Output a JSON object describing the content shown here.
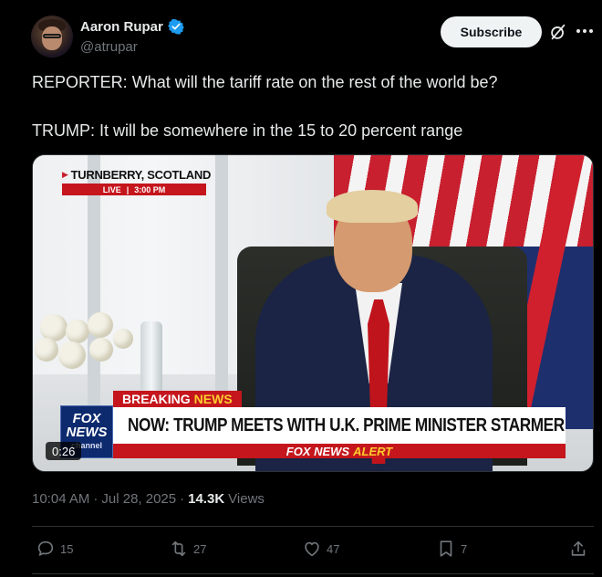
{
  "author": {
    "display_name": "Aaron Rupar",
    "handle": "@atrupar",
    "verified": true,
    "verified_color": "#1d9bf0"
  },
  "header": {
    "subscribe_label": "Subscribe",
    "grok_icon": "grok-icon",
    "more_icon": "more-icon"
  },
  "tweet": {
    "line1": "REPORTER: What will the tariff rate on the rest of the world be?",
    "line2": "TRUMP: It will be somewhere in the 15 to 20 percent range"
  },
  "video": {
    "location": "TURNBERRY, SCOTLAND",
    "live_label": "LIVE",
    "live_time": "3:00 PM",
    "breaking_word1": "BREAKING",
    "breaking_word2": "NEWS",
    "headline": "NOW: TRUMP MEETS WITH U.K. PRIME MINISTER STARMER",
    "alert_brand": "FOX NEWS",
    "alert_word": "ALERT",
    "logo_top": "FOX",
    "logo_bottom": "NEWS",
    "logo_channel": "channel",
    "duration": "0:26"
  },
  "meta": {
    "time": "10:04 AM",
    "separator": "·",
    "date": "Jul 28, 2025",
    "separator2": "·",
    "views_count": "14.3K",
    "views_label": "Views"
  },
  "actions": {
    "replies": "15",
    "reposts": "27",
    "likes": "47",
    "bookmarks": "7"
  },
  "colors": {
    "background": "#000000",
    "text": "#e7e9ea",
    "muted": "#71767b",
    "fox_red": "#c4161c"
  }
}
